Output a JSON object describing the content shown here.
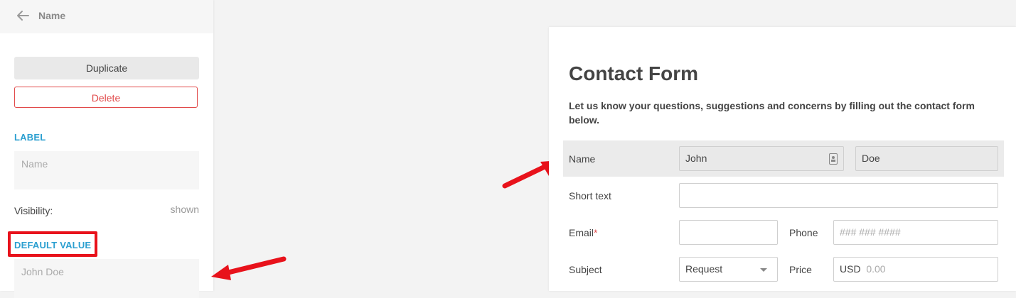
{
  "panel": {
    "title": "Name",
    "duplicate_label": "Duplicate",
    "delete_label": "Delete",
    "label_section": "LABEL",
    "label_value": "Name",
    "visibility_label": "Visibility:",
    "visibility_value": "shown",
    "default_value_section": "DEFAULT VALUE",
    "default_value": "John Doe",
    "highlight_color": "#e8121b",
    "accent_color": "#2b9fd0"
  },
  "form": {
    "title": "Contact Form",
    "description": "Let us know your questions, suggestions and concerns by filling out the contact form below.",
    "name_label": "Name",
    "first_name": "John",
    "last_name": "Doe",
    "short_text_label": "Short text",
    "email_label": "Email",
    "required_mark": "*",
    "phone_label": "Phone",
    "phone_placeholder": "### ### ####",
    "subject_label": "Subject",
    "subject_value": "Request",
    "price_label": "Price",
    "price_currency": "USD",
    "price_placeholder": "0.00"
  }
}
